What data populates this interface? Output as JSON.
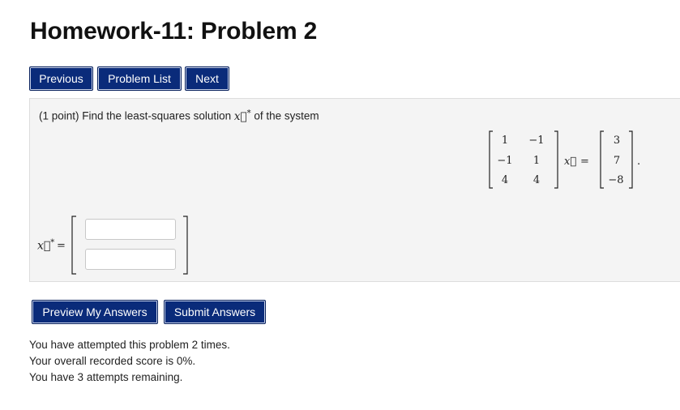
{
  "page": {
    "title": "Homework-11: Problem 2"
  },
  "nav": {
    "previous_label": "Previous",
    "problem_list_label": "Problem List",
    "next_label": "Next"
  },
  "problem": {
    "points_text": "(1 point) Find the least-squares solution",
    "points_suffix": "of the system",
    "vector_symbol": "x⃗",
    "star": "*",
    "matrix": [
      [
        "1",
        "−1"
      ],
      [
        "−1",
        "1"
      ],
      [
        "4",
        "4"
      ]
    ],
    "rhs": [
      "3",
      "7",
      "−8"
    ],
    "equals": "=",
    "period": ".",
    "answer_label": "x⃗",
    "answer_star": "*",
    "answer_equals": "="
  },
  "answers": {
    "field1_value": "",
    "field2_value": ""
  },
  "actions": {
    "preview_label": "Preview My Answers",
    "submit_label": "Submit Answers"
  },
  "status": {
    "attempted": "You have attempted this problem 2 times.",
    "score": "Your overall recorded score is 0%.",
    "remaining": "You have 3 attempts remaining."
  },
  "colors": {
    "button_bg": "#0a2b7a",
    "panel_bg": "#f4f4f4"
  }
}
